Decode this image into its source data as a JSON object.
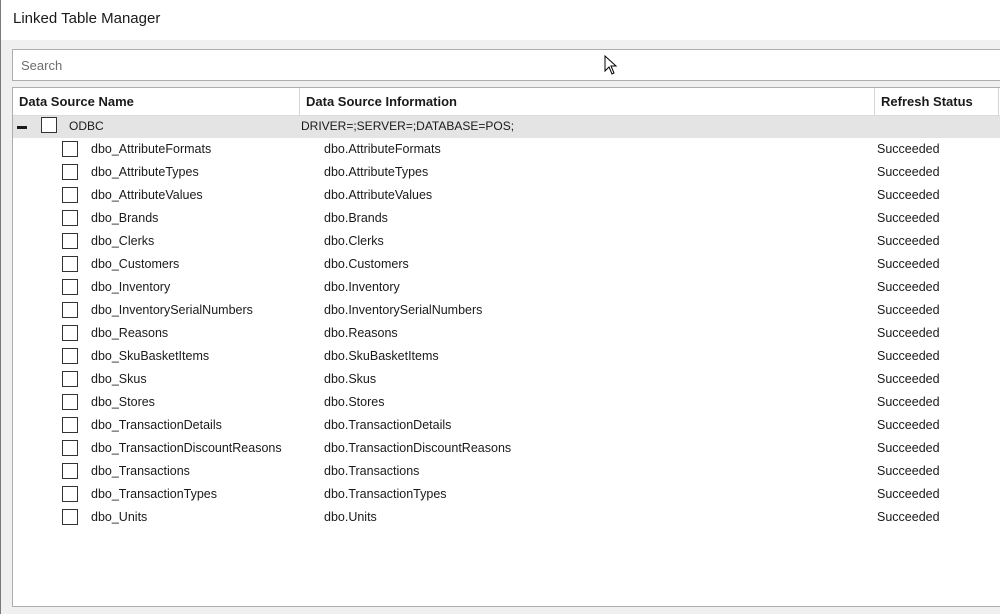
{
  "window": {
    "title": "Linked Table Manager"
  },
  "search": {
    "placeholder": "Search",
    "value": ""
  },
  "columns": {
    "name": "Data Source Name",
    "info": "Data Source Information",
    "status": "Refresh Status"
  },
  "group": {
    "name": "ODBC",
    "info": "DRIVER=;SERVER=;DATABASE=POS;"
  },
  "rows": [
    {
      "name": "dbo_AttributeFormats",
      "info": "dbo.AttributeFormats",
      "status": "Succeeded"
    },
    {
      "name": "dbo_AttributeTypes",
      "info": "dbo.AttributeTypes",
      "status": "Succeeded"
    },
    {
      "name": "dbo_AttributeValues",
      "info": "dbo.AttributeValues",
      "status": "Succeeded"
    },
    {
      "name": "dbo_Brands",
      "info": "dbo.Brands",
      "status": "Succeeded"
    },
    {
      "name": "dbo_Clerks",
      "info": "dbo.Clerks",
      "status": "Succeeded"
    },
    {
      "name": "dbo_Customers",
      "info": "dbo.Customers",
      "status": "Succeeded"
    },
    {
      "name": "dbo_Inventory",
      "info": "dbo.Inventory",
      "status": "Succeeded"
    },
    {
      "name": "dbo_InventorySerialNumbers",
      "info": "dbo.InventorySerialNumbers",
      "status": "Succeeded"
    },
    {
      "name": "dbo_Reasons",
      "info": "dbo.Reasons",
      "status": "Succeeded"
    },
    {
      "name": "dbo_SkuBasketItems",
      "info": "dbo.SkuBasketItems",
      "status": "Succeeded"
    },
    {
      "name": "dbo_Skus",
      "info": "dbo.Skus",
      "status": "Succeeded"
    },
    {
      "name": "dbo_Stores",
      "info": "dbo.Stores",
      "status": "Succeeded"
    },
    {
      "name": "dbo_TransactionDetails",
      "info": "dbo.TransactionDetails",
      "status": "Succeeded"
    },
    {
      "name": "dbo_TransactionDiscountReasons",
      "info": "dbo.TransactionDiscountReasons",
      "status": "Succeeded"
    },
    {
      "name": "dbo_Transactions",
      "info": "dbo.Transactions",
      "status": "Succeeded"
    },
    {
      "name": "dbo_TransactionTypes",
      "info": "dbo.TransactionTypes",
      "status": "Succeeded"
    },
    {
      "name": "dbo_Units",
      "info": "dbo.Units",
      "status": "Succeeded"
    }
  ]
}
